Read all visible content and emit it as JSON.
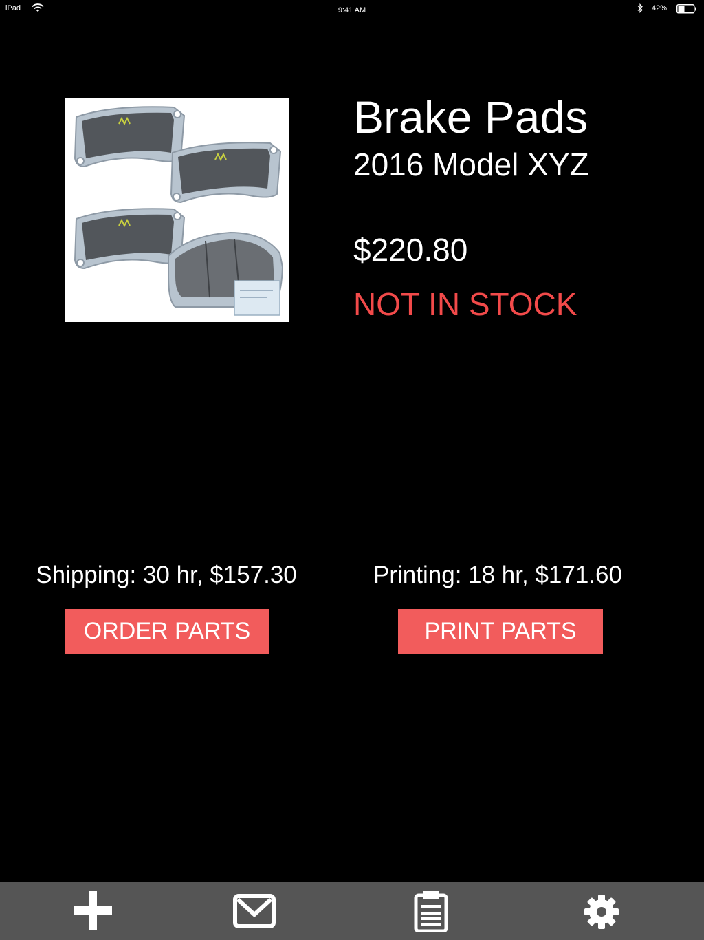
{
  "status_bar": {
    "device": "iPad",
    "time": "9:41 AM",
    "battery": "42%",
    "battery_level": 0.42
  },
  "product": {
    "title": "Brake Pads",
    "model": "2016 Model XYZ",
    "price": "$220.80",
    "stock_status": "NOT IN STOCK"
  },
  "options": {
    "shipping_text": "Shipping: 30 hr, $157.30",
    "printing_text": "Printing: 18 hr, $171.60",
    "order_button_label": "ORDER PARTS",
    "print_button_label": "PRINT PARTS"
  },
  "tab_bar": {
    "icons": [
      "plus-icon",
      "mail-icon",
      "clipboard-icon",
      "gear-icon"
    ]
  },
  "colors": {
    "background": "#000000",
    "accent": "#f25c5c",
    "stock_red": "#f24a4a",
    "tab_bar": "#555555",
    "text": "#ffffff"
  }
}
